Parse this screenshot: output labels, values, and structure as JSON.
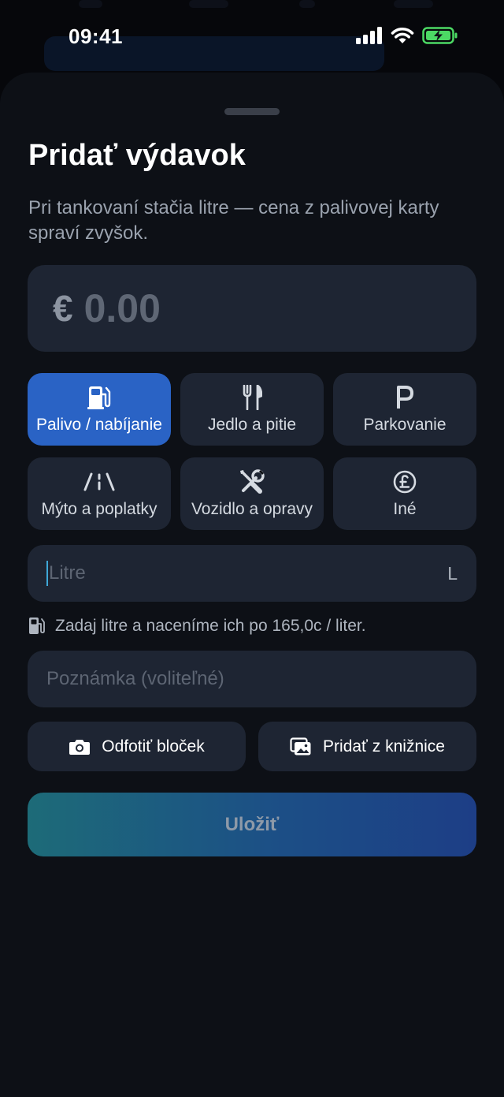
{
  "status_bar": {
    "time": "09:41"
  },
  "sheet": {
    "title": "Pridať výdavok",
    "subtitle": "Pri tankovaní stačia litre — cena z palivovej karty spraví zvyšok."
  },
  "amount": {
    "currency": "€",
    "value": "0.00"
  },
  "categories": [
    {
      "label": "Palivo / nabíjanie",
      "icon": "fuel-pump-icon",
      "selected": true
    },
    {
      "label": "Jedlo a pitie",
      "icon": "fork-knife-icon",
      "selected": false
    },
    {
      "label": "Parkovanie",
      "icon": "parking-p-icon",
      "selected": false
    },
    {
      "label": "Mýto a poplatky",
      "icon": "road-icon",
      "selected": false
    },
    {
      "label": "Vozidlo a opravy",
      "icon": "wrench-screwdriver-icon",
      "selected": false
    },
    {
      "label": "Iné",
      "icon": "pound-coin-icon",
      "selected": false
    }
  ],
  "liters_field": {
    "placeholder": "Litre",
    "unit": "L"
  },
  "hint": {
    "text": "Zadaj litre a naceníme ich po 165,0c / liter.",
    "icon": "fuel-pump-icon"
  },
  "note_field": {
    "placeholder": "Poznámka (voliteľné)"
  },
  "buttons": {
    "take_photo": "Odfotiť bloček",
    "from_library": "Pridať z knižnice",
    "save": "Uložiť"
  },
  "colors": {
    "accent_selected": "#2a63c5",
    "field_bg": "#1e2533",
    "sheet_bg": "#0d1016",
    "battery_green": "#4cd964"
  }
}
